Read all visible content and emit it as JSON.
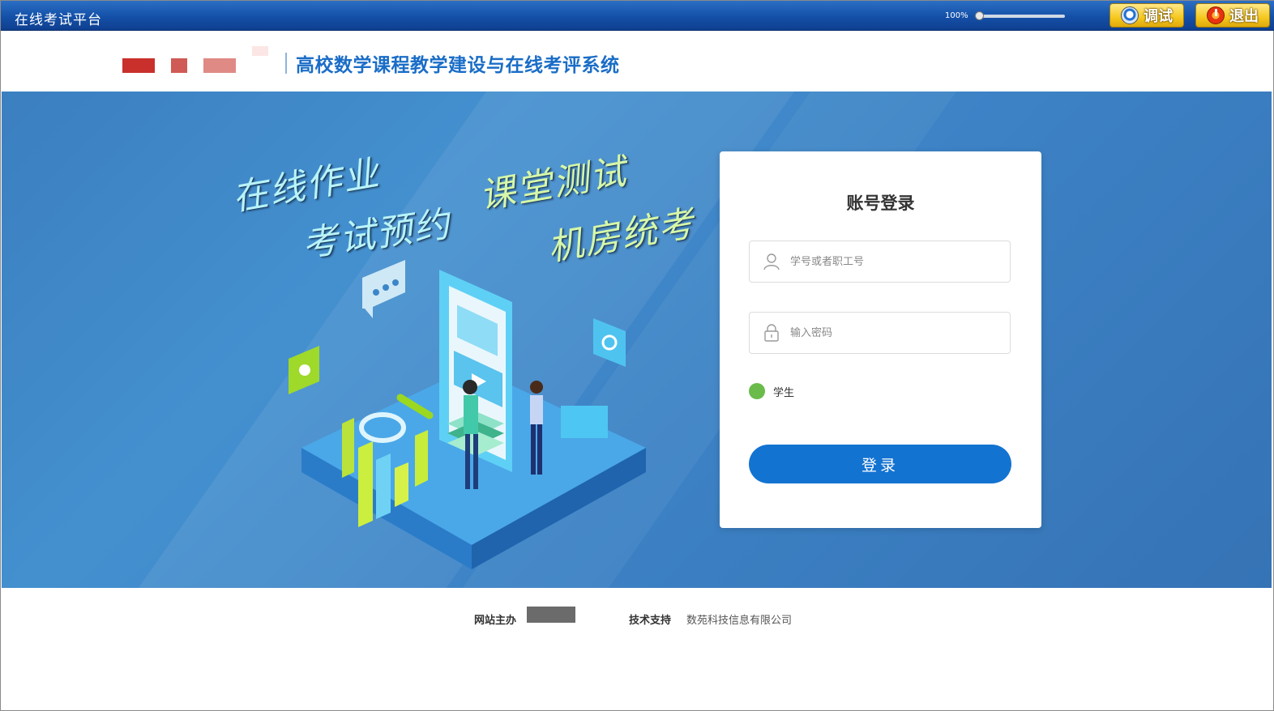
{
  "window": {
    "title": "在线考试平台",
    "zoom_label": "100%",
    "zoom_level": 0.0,
    "debug_label": "调试",
    "exit_label": "退出"
  },
  "header": {
    "site_title": "高校数学课程教学建设与在线考评系统"
  },
  "banner": {
    "slogans": [
      "在线作业",
      "考试预约",
      "课堂测试",
      "机房统考"
    ]
  },
  "login": {
    "title": "账号登录",
    "username_placeholder": "学号或者职工号",
    "password_placeholder": "输入密码",
    "role_label": "学生",
    "submit_label": "登录"
  },
  "footer": {
    "host_label": "网站主办",
    "support_label": "技术支持",
    "support_value": "数苑科技信息有限公司"
  },
  "colors": {
    "titlebar": "#1450a8",
    "accent": "#1373d1",
    "title_text": "#1a6dc7",
    "role_dot": "#6abb4a",
    "banner_bg": "#3d83c6"
  }
}
